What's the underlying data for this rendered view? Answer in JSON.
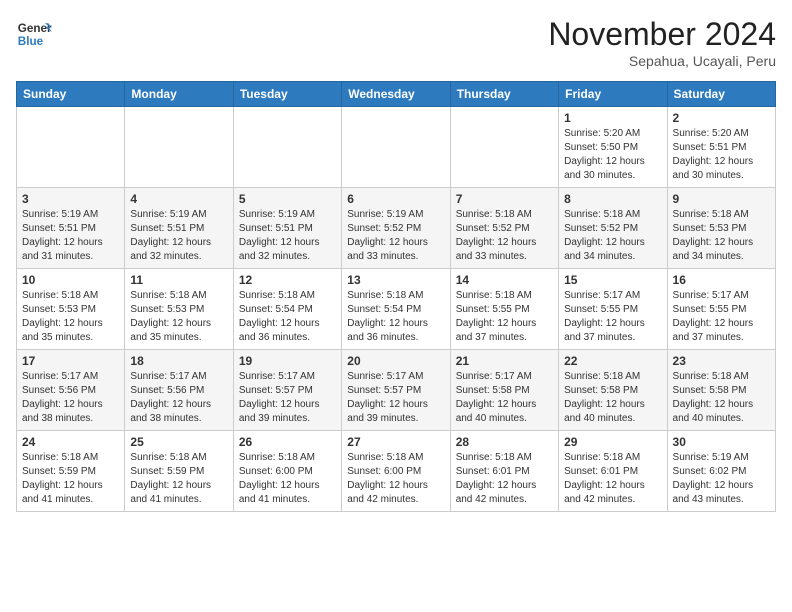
{
  "header": {
    "logo_line1": "General",
    "logo_line2": "Blue",
    "month_title": "November 2024",
    "location": "Sepahua, Ucayali, Peru"
  },
  "weekdays": [
    "Sunday",
    "Monday",
    "Tuesday",
    "Wednesday",
    "Thursday",
    "Friday",
    "Saturday"
  ],
  "weeks": [
    [
      {
        "day": "",
        "info": ""
      },
      {
        "day": "",
        "info": ""
      },
      {
        "day": "",
        "info": ""
      },
      {
        "day": "",
        "info": ""
      },
      {
        "day": "",
        "info": ""
      },
      {
        "day": "1",
        "info": "Sunrise: 5:20 AM\nSunset: 5:50 PM\nDaylight: 12 hours\nand 30 minutes."
      },
      {
        "day": "2",
        "info": "Sunrise: 5:20 AM\nSunset: 5:51 PM\nDaylight: 12 hours\nand 30 minutes."
      }
    ],
    [
      {
        "day": "3",
        "info": "Sunrise: 5:19 AM\nSunset: 5:51 PM\nDaylight: 12 hours\nand 31 minutes."
      },
      {
        "day": "4",
        "info": "Sunrise: 5:19 AM\nSunset: 5:51 PM\nDaylight: 12 hours\nand 32 minutes."
      },
      {
        "day": "5",
        "info": "Sunrise: 5:19 AM\nSunset: 5:51 PM\nDaylight: 12 hours\nand 32 minutes."
      },
      {
        "day": "6",
        "info": "Sunrise: 5:19 AM\nSunset: 5:52 PM\nDaylight: 12 hours\nand 33 minutes."
      },
      {
        "day": "7",
        "info": "Sunrise: 5:18 AM\nSunset: 5:52 PM\nDaylight: 12 hours\nand 33 minutes."
      },
      {
        "day": "8",
        "info": "Sunrise: 5:18 AM\nSunset: 5:52 PM\nDaylight: 12 hours\nand 34 minutes."
      },
      {
        "day": "9",
        "info": "Sunrise: 5:18 AM\nSunset: 5:53 PM\nDaylight: 12 hours\nand 34 minutes."
      }
    ],
    [
      {
        "day": "10",
        "info": "Sunrise: 5:18 AM\nSunset: 5:53 PM\nDaylight: 12 hours\nand 35 minutes."
      },
      {
        "day": "11",
        "info": "Sunrise: 5:18 AM\nSunset: 5:53 PM\nDaylight: 12 hours\nand 35 minutes."
      },
      {
        "day": "12",
        "info": "Sunrise: 5:18 AM\nSunset: 5:54 PM\nDaylight: 12 hours\nand 36 minutes."
      },
      {
        "day": "13",
        "info": "Sunrise: 5:18 AM\nSunset: 5:54 PM\nDaylight: 12 hours\nand 36 minutes."
      },
      {
        "day": "14",
        "info": "Sunrise: 5:18 AM\nSunset: 5:55 PM\nDaylight: 12 hours\nand 37 minutes."
      },
      {
        "day": "15",
        "info": "Sunrise: 5:17 AM\nSunset: 5:55 PM\nDaylight: 12 hours\nand 37 minutes."
      },
      {
        "day": "16",
        "info": "Sunrise: 5:17 AM\nSunset: 5:55 PM\nDaylight: 12 hours\nand 37 minutes."
      }
    ],
    [
      {
        "day": "17",
        "info": "Sunrise: 5:17 AM\nSunset: 5:56 PM\nDaylight: 12 hours\nand 38 minutes."
      },
      {
        "day": "18",
        "info": "Sunrise: 5:17 AM\nSunset: 5:56 PM\nDaylight: 12 hours\nand 38 minutes."
      },
      {
        "day": "19",
        "info": "Sunrise: 5:17 AM\nSunset: 5:57 PM\nDaylight: 12 hours\nand 39 minutes."
      },
      {
        "day": "20",
        "info": "Sunrise: 5:17 AM\nSunset: 5:57 PM\nDaylight: 12 hours\nand 39 minutes."
      },
      {
        "day": "21",
        "info": "Sunrise: 5:17 AM\nSunset: 5:58 PM\nDaylight: 12 hours\nand 40 minutes."
      },
      {
        "day": "22",
        "info": "Sunrise: 5:18 AM\nSunset: 5:58 PM\nDaylight: 12 hours\nand 40 minutes."
      },
      {
        "day": "23",
        "info": "Sunrise: 5:18 AM\nSunset: 5:58 PM\nDaylight: 12 hours\nand 40 minutes."
      }
    ],
    [
      {
        "day": "24",
        "info": "Sunrise: 5:18 AM\nSunset: 5:59 PM\nDaylight: 12 hours\nand 41 minutes."
      },
      {
        "day": "25",
        "info": "Sunrise: 5:18 AM\nSunset: 5:59 PM\nDaylight: 12 hours\nand 41 minutes."
      },
      {
        "day": "26",
        "info": "Sunrise: 5:18 AM\nSunset: 6:00 PM\nDaylight: 12 hours\nand 41 minutes."
      },
      {
        "day": "27",
        "info": "Sunrise: 5:18 AM\nSunset: 6:00 PM\nDaylight: 12 hours\nand 42 minutes."
      },
      {
        "day": "28",
        "info": "Sunrise: 5:18 AM\nSunset: 6:01 PM\nDaylight: 12 hours\nand 42 minutes."
      },
      {
        "day": "29",
        "info": "Sunrise: 5:18 AM\nSunset: 6:01 PM\nDaylight: 12 hours\nand 42 minutes."
      },
      {
        "day": "30",
        "info": "Sunrise: 5:19 AM\nSunset: 6:02 PM\nDaylight: 12 hours\nand 43 minutes."
      }
    ]
  ]
}
